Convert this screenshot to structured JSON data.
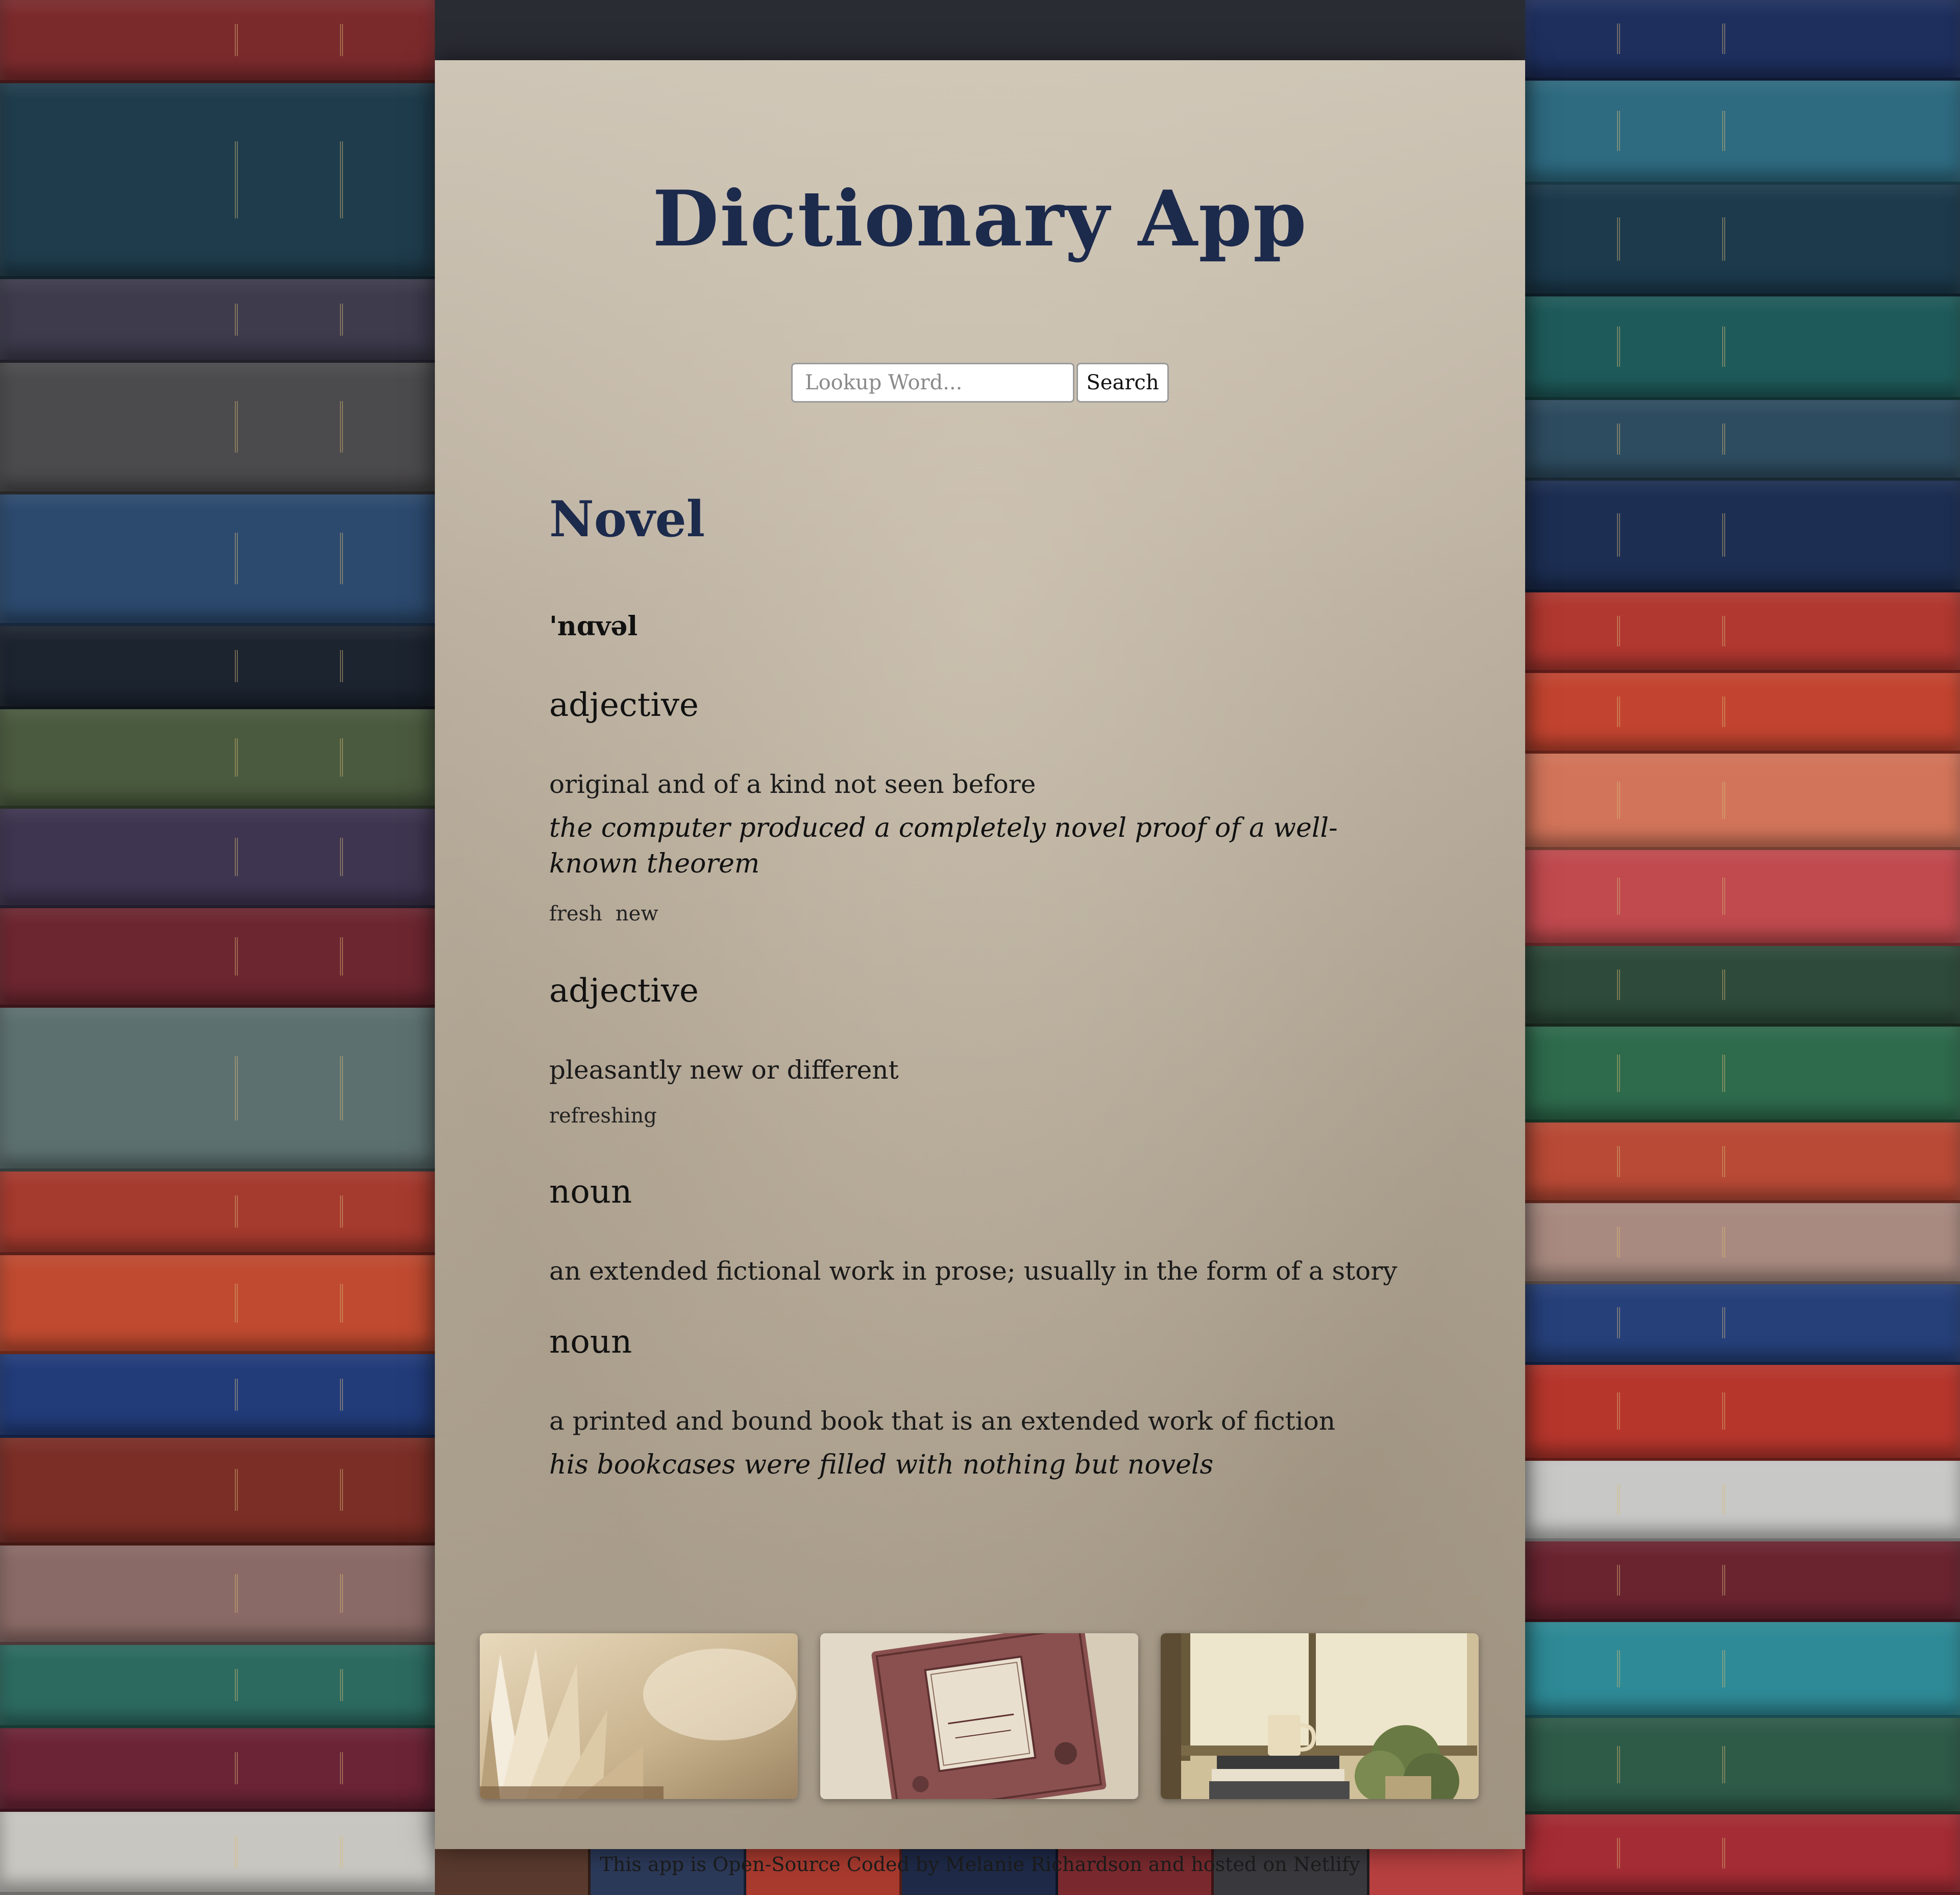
{
  "app": {
    "title": "Dictionary App"
  },
  "search": {
    "placeholder": "Lookup Word...",
    "value": "",
    "button_label": "Search"
  },
  "result": {
    "word": "Novel",
    "phonetic": "'nɑvəl",
    "meanings": [
      {
        "part_of_speech": "adjective",
        "definition": "original and of a kind not seen before",
        "example": "the computer produced a completely novel proof of a well-known theorem",
        "synonyms": [
          "fresh",
          "new"
        ]
      },
      {
        "part_of_speech": "adjective",
        "definition": "pleasantly new or different",
        "example": "",
        "synonyms": [
          "refreshing"
        ]
      },
      {
        "part_of_speech": "noun",
        "definition": "an extended fictional work in prose; usually in the form of a story",
        "example": "",
        "synonyms": []
      },
      {
        "part_of_speech": "noun",
        "definition": "a printed and bound book that is an extended work of fiction",
        "example": "his bookcases were filled with nothing but novels",
        "synonyms": []
      }
    ]
  },
  "footer": {
    "text": "This app is Open-Source Coded by Melanie Richardson and hosted on Netlify"
  },
  "colors": {
    "title": "#1c2a4c",
    "parchment": "#bdb2a2"
  }
}
